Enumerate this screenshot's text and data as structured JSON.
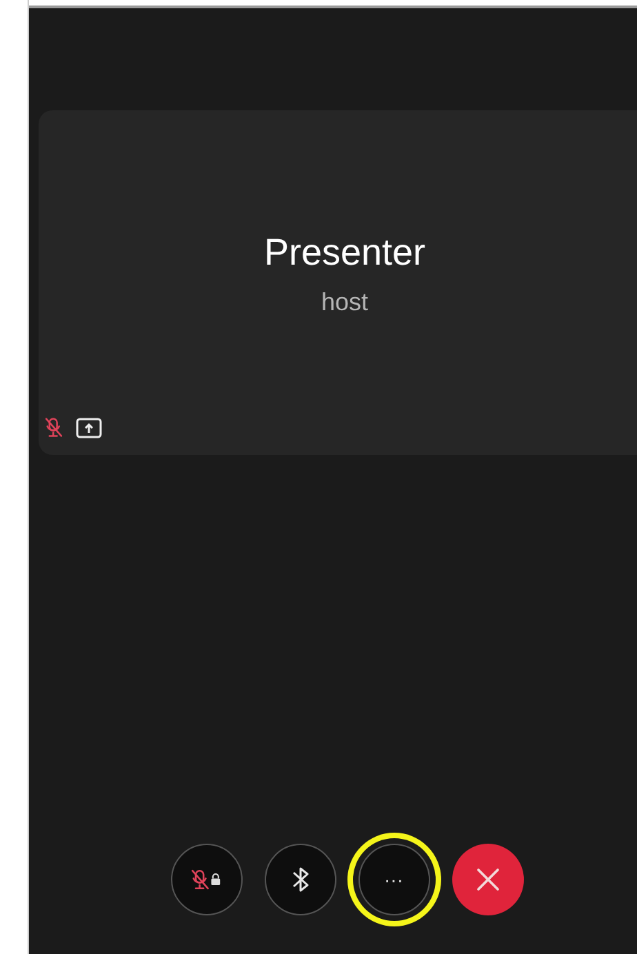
{
  "participant": {
    "name": "Presenter",
    "role": "host",
    "muted": true,
    "sharing": true
  },
  "controls": [
    {
      "kind": "mute",
      "highlighted": false
    },
    {
      "kind": "bluetooth",
      "highlighted": false
    },
    {
      "kind": "more",
      "label": "···",
      "highlighted": true
    },
    {
      "kind": "end",
      "highlighted": false
    }
  ]
}
